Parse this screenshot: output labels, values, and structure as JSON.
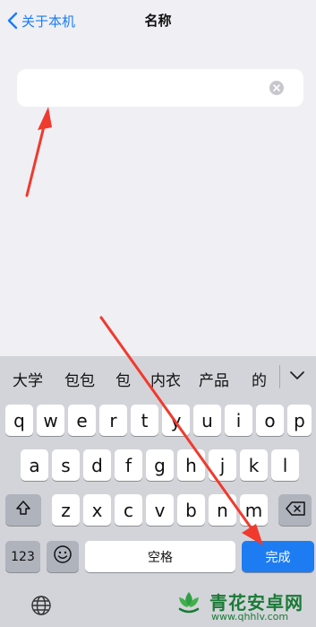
{
  "navbar": {
    "back_label": "关于本机",
    "title": "名称"
  },
  "name_field": {
    "value": "",
    "placeholder": ""
  },
  "keyboard": {
    "candidates": [
      "大学",
      "包包",
      "包",
      "内衣",
      "产品",
      "的"
    ],
    "row1": [
      "q",
      "w",
      "e",
      "r",
      "t",
      "y",
      "u",
      "i",
      "o",
      "p"
    ],
    "row2": [
      "a",
      "s",
      "d",
      "f",
      "g",
      "h",
      "j",
      "k",
      "l"
    ],
    "row3": [
      "z",
      "x",
      "c",
      "v",
      "b",
      "n",
      "m"
    ],
    "numbers_label": "123",
    "space_label": "空格",
    "done_label": "完成"
  },
  "watermark": {
    "title": "青花安卓网",
    "url": "www.qhhlv.com"
  },
  "colors": {
    "accent": "#1a7cf5",
    "done_button": "#1e7cf2",
    "arrow": "#ff3b30",
    "background": "#efeff4",
    "keyboard": "#d3d4d9"
  },
  "icons": [
    "chevron-left-icon",
    "clear-icon",
    "chevron-down-icon",
    "shift-icon",
    "backspace-icon",
    "emoji-icon",
    "globe-icon"
  ]
}
